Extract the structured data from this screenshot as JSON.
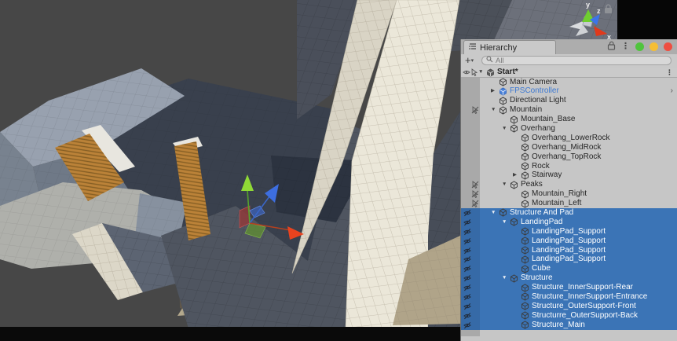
{
  "viewport": {
    "axis_gizmo": {
      "x": "x",
      "y": "y",
      "z": "z"
    }
  },
  "colors": {
    "selection": "#3B74B6",
    "prefab_text": "#3D79D2",
    "traffic_green": "#50C43E",
    "traffic_yellow": "#F5BE34",
    "traffic_red": "#EE4E41",
    "gizmo_x": "#E8431F",
    "gizmo_y": "#8FD936",
    "gizmo_z": "#3D6EE0"
  },
  "hierarchy": {
    "tab_title": "Hierarchy",
    "create_label": "+",
    "search_placeholder": "All",
    "items": [
      {
        "label": "Start*",
        "depth": 0,
        "twisty": "open",
        "icon": "scene",
        "header": true,
        "gutter": "eye-pick",
        "trailing": "menu"
      },
      {
        "label": "Main Camera",
        "depth": 1,
        "twisty": null,
        "icon": "cube"
      },
      {
        "label": "FPSController",
        "depth": 1,
        "twisty": "closed",
        "icon": "prefab",
        "prefab": true,
        "trailing": "chevron"
      },
      {
        "label": "Directional Light",
        "depth": 1,
        "twisty": null,
        "icon": "cube"
      },
      {
        "label": "Mountain",
        "depth": 1,
        "twisty": "open",
        "icon": "cube",
        "gutter": "pick-off"
      },
      {
        "label": "Mountain_Base",
        "depth": 2,
        "twisty": null,
        "icon": "cube"
      },
      {
        "label": "Overhang",
        "depth": 2,
        "twisty": "open",
        "icon": "cube"
      },
      {
        "label": "Overhang_LowerRock",
        "depth": 3,
        "twisty": null,
        "icon": "cube"
      },
      {
        "label": "Overhang_MidRock",
        "depth": 3,
        "twisty": null,
        "icon": "cube"
      },
      {
        "label": "Overhang_TopRock",
        "depth": 3,
        "twisty": null,
        "icon": "cube"
      },
      {
        "label": "Rock",
        "depth": 3,
        "twisty": null,
        "icon": "cube"
      },
      {
        "label": "Stairway",
        "depth": 3,
        "twisty": "closed",
        "icon": "cube"
      },
      {
        "label": "Peaks",
        "depth": 2,
        "twisty": "open",
        "icon": "cube",
        "gutter": "pick-off"
      },
      {
        "label": "Mountain_Right",
        "depth": 3,
        "twisty": null,
        "icon": "cube",
        "gutter": "pick-off"
      },
      {
        "label": "Mountain_Left",
        "depth": 3,
        "twisty": null,
        "icon": "cube",
        "gutter": "pick-off"
      },
      {
        "label": "Structure And Pad",
        "depth": 1,
        "twisty": "open",
        "icon": "cube",
        "selected": true,
        "gutter": "eye-off"
      },
      {
        "label": "LandingPad",
        "depth": 2,
        "twisty": "open",
        "icon": "cube",
        "selected": true,
        "gutter": "eye-off"
      },
      {
        "label": "LandingPad_Support",
        "depth": 3,
        "twisty": null,
        "icon": "cube",
        "selected": true,
        "gutter": "eye-off"
      },
      {
        "label": "LandingPad_Support",
        "depth": 3,
        "twisty": null,
        "icon": "cube",
        "selected": true,
        "gutter": "eye-off"
      },
      {
        "label": "LandingPad_Support",
        "depth": 3,
        "twisty": null,
        "icon": "cube",
        "selected": true,
        "gutter": "eye-off"
      },
      {
        "label": "LandingPad_Support",
        "depth": 3,
        "twisty": null,
        "icon": "cube",
        "selected": true,
        "gutter": "eye-off"
      },
      {
        "label": "Cube",
        "depth": 3,
        "twisty": null,
        "icon": "cube",
        "selected": true,
        "gutter": "eye-off"
      },
      {
        "label": "Structure",
        "depth": 2,
        "twisty": "open",
        "icon": "cube",
        "selected": true,
        "gutter": "eye-off"
      },
      {
        "label": "Structure_InnerSupport-Rear",
        "depth": 3,
        "twisty": null,
        "icon": "cube",
        "selected": true,
        "gutter": "eye-off"
      },
      {
        "label": "Structure_InnerSupport-Entrance",
        "depth": 3,
        "twisty": null,
        "icon": "cube",
        "selected": true,
        "gutter": "eye-off"
      },
      {
        "label": "Structure_OuterSupport-Front",
        "depth": 3,
        "twisty": null,
        "icon": "cube",
        "selected": true,
        "gutter": "eye-off"
      },
      {
        "label": "Structurre_OuterSupport-Back",
        "depth": 3,
        "twisty": null,
        "icon": "cube",
        "selected": true,
        "gutter": "eye-off"
      },
      {
        "label": "Structure_Main",
        "depth": 3,
        "twisty": null,
        "icon": "cube",
        "selected": true,
        "gutter": "eye-off"
      }
    ]
  }
}
